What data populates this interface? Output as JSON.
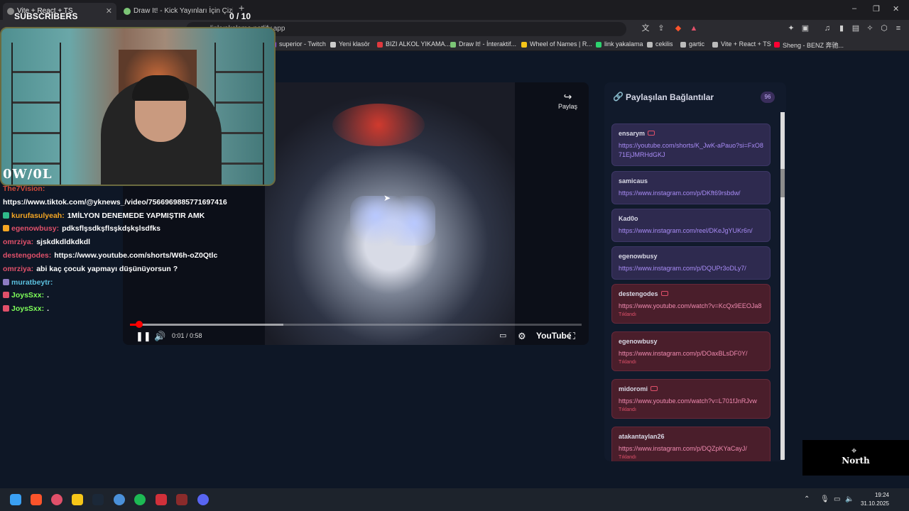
{
  "browser": {
    "tabs": [
      {
        "title": "Vite + React + TS",
        "active": true
      },
      {
        "title": "Draw It! - Kick Yayınları İçin Çizim ve",
        "active": false
      }
    ],
    "url": "linkyakalama.netlify.app",
    "bookmarks": [
      {
        "label": "superior - Twitch",
        "color": "#9147ff"
      },
      {
        "label": "Yeni klasör",
        "color": "#cccccc"
      },
      {
        "label": "BIZI ALKOL YIKAMA...",
        "color": "#e0393e"
      },
      {
        "label": "Draw It! - İnteraktif...",
        "color": "#7cc576"
      },
      {
        "label": "Wheel of Names | R...",
        "color": "#f5c518"
      },
      {
        "label": "link yakalama",
        "color": "#2dd36f"
      },
      {
        "label": "cekilis",
        "color": "#bbbbbb"
      },
      {
        "label": "gartic",
        "color": "#bbbbbb"
      },
      {
        "label": "Vite + React + TS",
        "color": "#bbbbbb"
      },
      {
        "label": "Sheng - BENZ 奔驰...",
        "color": "#ff0033"
      }
    ]
  },
  "overlay": {
    "subscribers_label": "SUBSCRIBERS",
    "subscribers_count": "0  / 10",
    "logo": "0W/0L"
  },
  "chat": [
    {
      "user": "The7Vision:",
      "color": "#d04a3a",
      "text": "",
      "badge": ""
    },
    {
      "user": "",
      "color": "#ffffff",
      "text": "https://www.tiktok.com/@yknews_/video/7566969885771697416",
      "badge": ""
    },
    {
      "user": "kurufasulyeah:",
      "color": "#f5a623",
      "text": "1MİLYON DENEMEDE YAPMIŞTIR AMK",
      "badge": "#2fb98a"
    },
    {
      "user": "egenowbusy:",
      "color": "#e0506a",
      "text": "pdksflşsdkşflsşkdşkşlsdfks",
      "badge": "#f5a623"
    },
    {
      "user": "omrziya:",
      "color": "#e0506a",
      "text": "sjskdkdldkdkdl",
      "badge": ""
    },
    {
      "user": "destengodes:",
      "color": "#e0506a",
      "text": "https://www.youtube.com/shorts/W6h-oZ0Qtlc",
      "badge": ""
    },
    {
      "user": "omrziya:",
      "color": "#e0506a",
      "text": "abi kaç çocuk yapmayı düşünüyorsun ?",
      "badge": ""
    },
    {
      "user": "muratbeytr:",
      "color": "#5bc0de",
      "text": "",
      "badge": "#8e7cc3"
    },
    {
      "user": "JoysSxx:",
      "color": "#7fff5a",
      "text": ".",
      "badge": "#e0506a"
    },
    {
      "user": "JoysSxx:",
      "color": "#7fff5a",
      "text": ".",
      "badge": "#e0506a"
    }
  ],
  "player": {
    "share_label": "Paylaş",
    "time": "0:01 / 0:58",
    "brand": "YouTube",
    "progress_played_percent": 2,
    "progress_buffered_percent": 34
  },
  "panel": {
    "title": "Paylaşılan Bağlantılar",
    "count": "96",
    "items": [
      {
        "user": "ensarym",
        "url": "https://youtube.com/shorts/K_JwK-aPauo?si=FxO871EjJMRHdGKJ",
        "yt": true,
        "clicked": "",
        "style": "p"
      },
      {
        "user": "samicaus",
        "url": "https://www.instagram.com/p/DKft69rsbdw/",
        "yt": false,
        "clicked": "",
        "style": "p"
      },
      {
        "user": "Kad0o",
        "url": "https://www.instagram.com/reel/DKeJgYUKr6n/",
        "yt": false,
        "clicked": "",
        "style": "p"
      },
      {
        "user": "egenowbusy",
        "url": "https://www.instagram.com/p/DQUPr3oDLy7/",
        "yt": false,
        "clicked": "",
        "style": "p"
      },
      {
        "user": "destengodes",
        "url": "https://www.youtube.com/watch?v=KcQx9EEOJa8",
        "yt": true,
        "clicked": "Tıklandı",
        "style": "r"
      },
      {
        "user": "egenowbusy",
        "url": "https://www.instagram.com/p/DOaxBLsDF0Y/",
        "yt": false,
        "clicked": "Tıklandı",
        "style": "r"
      },
      {
        "user": "midoromi",
        "url": "https://www.youtube.com/watch?v=L701fJnRJvw",
        "yt": true,
        "clicked": "Tıklandı",
        "style": "r"
      },
      {
        "user": "atakantaylan26",
        "url": "https://www.instagram.com/p/DQZpKYaCayJ/",
        "yt": false,
        "clicked": "Tıklandı",
        "style": "r"
      }
    ]
  },
  "north": {
    "label": "North"
  },
  "taskbar": {
    "time": "19:24",
    "date": "31.10.2025"
  }
}
